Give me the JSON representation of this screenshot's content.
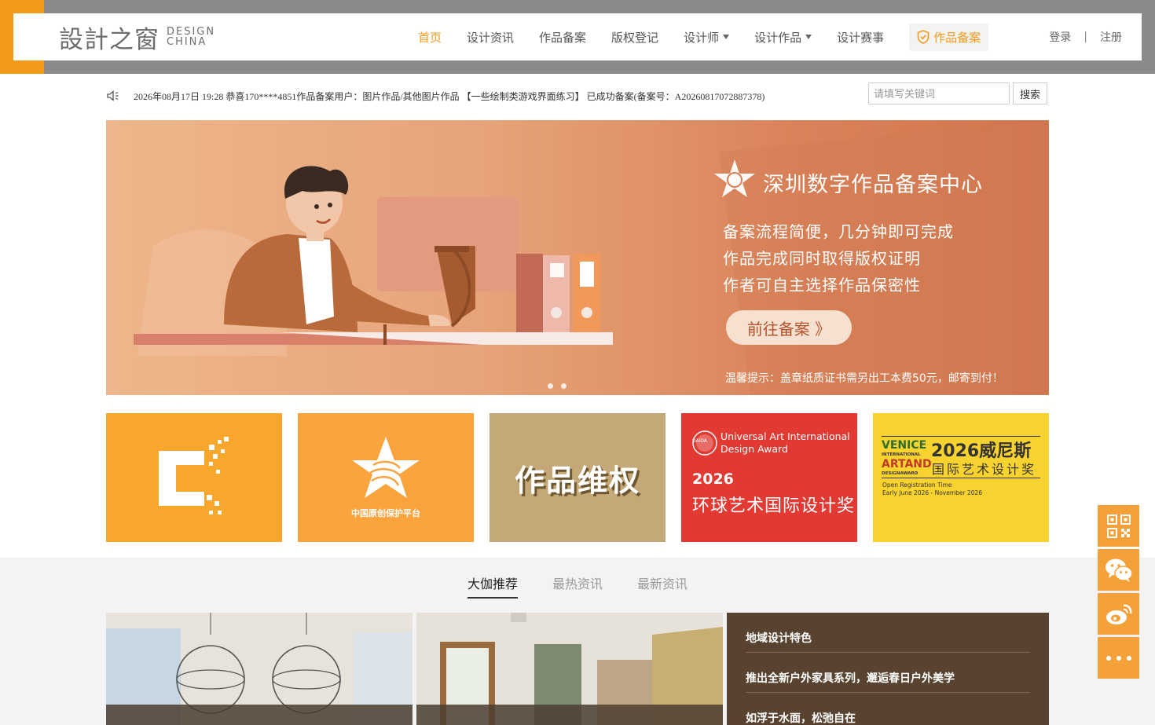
{
  "header": {
    "logo_cn": "設計之窗",
    "logo_en_1": "DESIGN",
    "logo_en_2": "CHINA",
    "nav": [
      {
        "label": "首页"
      },
      {
        "label": "设计资讯"
      },
      {
        "label": "作品备案"
      },
      {
        "label": "版权登记"
      },
      {
        "label": "设计师"
      },
      {
        "label": "设计作品"
      },
      {
        "label": "设计赛事"
      },
      {
        "label": "作品备案"
      }
    ],
    "login": "登录",
    "divider": "|",
    "register": "注册"
  },
  "notice": {
    "text": "2026年08月17日 19:28   恭喜170****4851作品备案用户：图片作品/其他图片作品 【一些绘制类游戏界面练习】 已成功备案(备案号：A20260817072887378)"
  },
  "search": {
    "placeholder": "请填写关键词",
    "button": "搜索"
  },
  "banner": {
    "title": "深圳数字作品备案中心",
    "lines": [
      "备案流程简便，几分钟即可完成",
      "作品完成同时取得版权证明",
      "作者可自主选择作品保密性"
    ],
    "cta": "前往备案 》",
    "tip": "温馨提示：盖章纸质证书需另出工本费50元，邮寄到付！"
  },
  "tiles": {
    "t2_caption": "中国原创保护平台",
    "t3_text": "作品维权",
    "t4_line1": "Universal Art International",
    "t4_line2": "Design Award",
    "t4_year": "2026",
    "t4_cn": "环球艺术国际设计奖",
    "t4_badge": "UAIDA",
    "t5_logo_1": "VENICE",
    "t5_logo_2": "INTERNATIONAL",
    "t5_logo_3": "ARTAND",
    "t5_logo_4": "DESIGNAWARD",
    "t5_title1": "2026威尼斯",
    "t5_title2": "国际艺术设计奖",
    "t5_reg1": "Open Registration Time",
    "t5_reg2": "Early June 2026 - November 2026"
  },
  "news": {
    "tabs": [
      {
        "label": "大伽推荐"
      },
      {
        "label": "最热资讯"
      },
      {
        "label": "最新资讯"
      }
    ],
    "items": [
      "地域设计特色",
      "推出全新户外家具系列，邂逅春日户外美学",
      "如浮于水面，松弛自在"
    ]
  },
  "colors": {
    "brand_orange": "#f39a1a",
    "header_gray": "#8a8a8a",
    "news_brown": "#57432f"
  },
  "icons": [
    "speaker-icon",
    "shield-icon",
    "qrcode-icon",
    "wechat-icon",
    "weibo-icon",
    "more-icon"
  ]
}
